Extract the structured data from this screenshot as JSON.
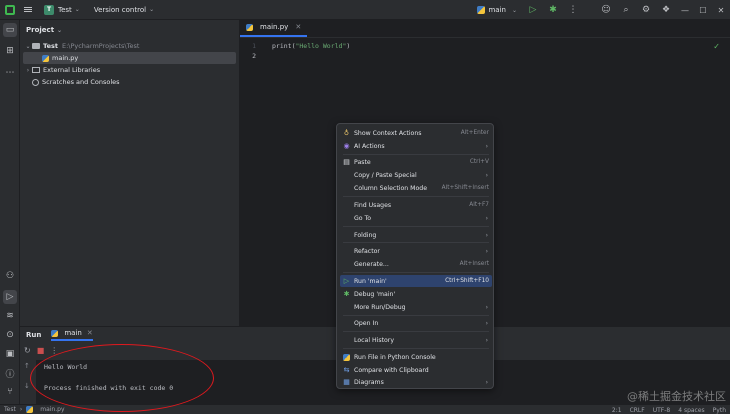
{
  "titlebar": {
    "project_badge": "T",
    "project_name": "Test",
    "vcs_label": "Version control",
    "run_config": "main"
  },
  "project_panel": {
    "title": "Project",
    "root_name": "Test",
    "root_path": "E:\\PycharmProjects\\Test",
    "file": "main.py",
    "external_libs": "External Libraries",
    "scratches": "Scratches and Consoles"
  },
  "editor": {
    "tab_label": "main.py",
    "lines": [
      {
        "num": "1",
        "prefix": "print(",
        "string": "\"Hello World\"",
        "suffix": ")"
      },
      {
        "num": "2",
        "prefix": "",
        "string": "",
        "suffix": ""
      }
    ]
  },
  "run_panel": {
    "title": "Run",
    "tab_label": "main",
    "output_line1": "Hello World",
    "output_line2": "Process finished with exit code 0"
  },
  "statusbar": {
    "breadcrumb_project": "Test",
    "breadcrumb_file": "main.py",
    "position": "2:1",
    "line_sep": "CRLF",
    "encoding": "UTF-8",
    "indent": "4 spaces",
    "interpreter": "Pyth"
  },
  "context_menu": {
    "items": [
      {
        "label": "Show Context Actions",
        "shortcut": "Alt+Enter",
        "icon": "bulb-icon"
      },
      {
        "label": "AI Actions",
        "submenu": true,
        "icon": "ai-icon"
      },
      {
        "label": "Paste",
        "shortcut": "Ctrl+V",
        "icon": "paste-icon"
      },
      {
        "label": "Copy / Paste Special",
        "submenu": true
      },
      {
        "label": "Column Selection Mode",
        "shortcut": "Alt+Shift+Insert"
      },
      {
        "label": "Find Usages",
        "shortcut": "Alt+F7"
      },
      {
        "label": "Go To",
        "submenu": true
      },
      {
        "label": "Folding",
        "submenu": true
      },
      {
        "label": "Refactor",
        "submenu": true
      },
      {
        "label": "Generate...",
        "shortcut": "Alt+Insert"
      },
      {
        "label": "Run 'main'",
        "shortcut": "Ctrl+Shift+F10",
        "icon": "run-icon"
      },
      {
        "label": "Debug 'main'",
        "icon": "debug-icon"
      },
      {
        "label": "More Run/Debug",
        "submenu": true
      },
      {
        "label": "Open In",
        "submenu": true
      },
      {
        "label": "Local History",
        "submenu": true
      },
      {
        "label": "Run File in Python Console",
        "icon": "python-console-icon"
      },
      {
        "label": "Compare with Clipboard",
        "icon": "compare-icon"
      },
      {
        "label": "Diagrams",
        "submenu": true,
        "icon": "diagram-icon"
      }
    ]
  },
  "watermark": "@稀土掘金技术社区",
  "colors": {
    "accent": "#3574f0",
    "highlight": "#2e436e",
    "annotation": "#e0191e",
    "run_green": "#5fb865"
  }
}
